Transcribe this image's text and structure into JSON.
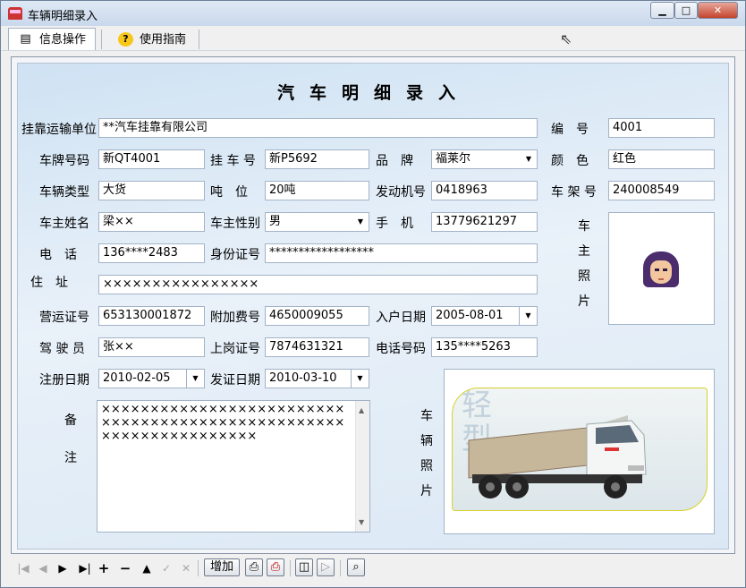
{
  "window": {
    "title": "车辆明细录入",
    "min": "0",
    "max": "1",
    "close": "r"
  },
  "menu": {
    "tabs": [
      {
        "label": "信息操作"
      },
      {
        "label": "使用指南"
      }
    ]
  },
  "form": {
    "title": "汽车明细录入",
    "labels": {
      "unit": "挂靠运输单位",
      "code": "编　号",
      "plate": "车牌号码",
      "trailer": "挂 车 号",
      "brand": "品　牌",
      "color": "颜　色",
      "type": "车辆类型",
      "tonnage": "吨　位",
      "engine": "发动机号",
      "frame": "车 架 号",
      "owner_name": "车主姓名",
      "owner_gender": "车主性别",
      "mobile": "手　机",
      "owner_photo": "车主照片",
      "phone": "电　话",
      "id_card": "身份证号",
      "address": "住　址",
      "license": "营运证号",
      "surcharge": "附加费号",
      "entry_date": "入户日期",
      "driver": "驾 驶 员",
      "post_cert": "上岗证号",
      "tel": "电话号码",
      "reg_date": "注册日期",
      "issue_date": "发证日期",
      "remark": "备注",
      "car_photo": "车辆照片"
    },
    "values": {
      "unit": "**汽车挂靠有限公司",
      "code": "4001",
      "plate": "新QT4001",
      "trailer": "新P5692",
      "brand": "福莱尔",
      "color": "红色",
      "type": "大货",
      "tonnage": "20吨",
      "engine": "0418963",
      "frame": "240008549",
      "owner_name": "梁××",
      "owner_gender": "男",
      "mobile": "13779621297",
      "phone": "136****2483",
      "id_card": "******************",
      "address": "××××××××××××××××",
      "license": "653130001872",
      "surcharge": "4650009055",
      "entry_date": "2005-08-01",
      "driver": "张××",
      "post_cert": "7874631321",
      "tel": "135****5263",
      "reg_date": "2010-02-05",
      "issue_date": "2010-03-10",
      "remark": "××××××××××××××××××××××××××××××××××××××××××××××××××××××××××××××××××"
    },
    "watermark": "轻型"
  },
  "toolbar": {
    "add_label": "增加"
  }
}
